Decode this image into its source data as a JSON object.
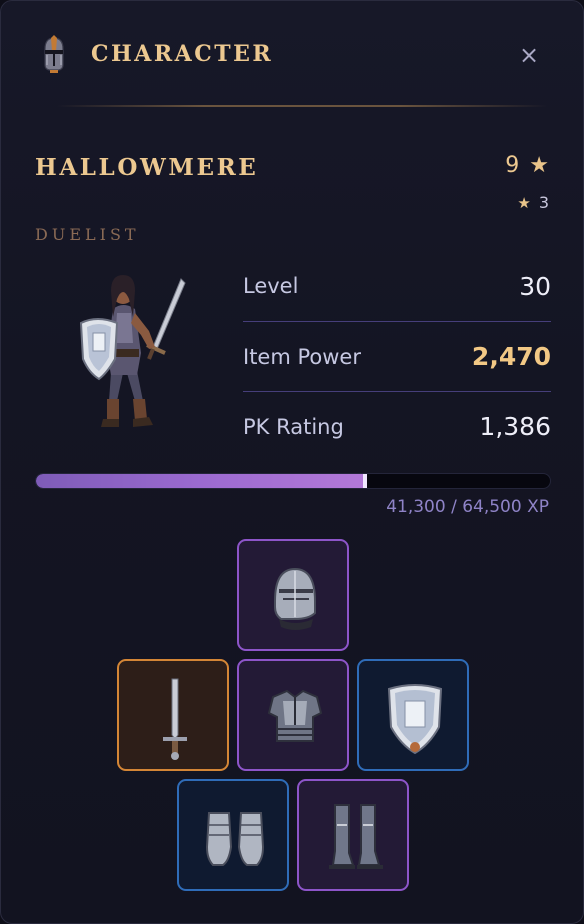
{
  "header": {
    "title": "CHARACTER",
    "icon": "knight-helm-icon",
    "close_label": "×"
  },
  "character": {
    "name": "HALLOWMERE",
    "class": "DUELIST",
    "stars": "9",
    "sub_stars": "3",
    "portrait": "duelist-portrait"
  },
  "stats": [
    {
      "label": "Level",
      "value": "30"
    },
    {
      "label": "Item Power",
      "value": "2,470"
    },
    {
      "label": "PK Rating",
      "value": "1,386"
    }
  ],
  "xp": {
    "current": 41300,
    "max": 64500,
    "text": "41,300 / 64,500 XP"
  },
  "equipment": [
    {
      "slot": "head",
      "item": "knight-helmet-icon",
      "rarity": "epic",
      "color": "#8d55c9"
    },
    {
      "slot": "weapon",
      "item": "longsword-icon",
      "rarity": "legendary",
      "color": "#d48636"
    },
    {
      "slot": "chest",
      "item": "plate-armor-icon",
      "rarity": "epic",
      "color": "#8d55c9"
    },
    {
      "slot": "offhand",
      "item": "kite-shield-icon",
      "rarity": "rare",
      "color": "#2f6cb8"
    },
    {
      "slot": "hands",
      "item": "gauntlets-icon",
      "rarity": "rare",
      "color": "#2f6cb8"
    },
    {
      "slot": "feet",
      "item": "greaves-icon",
      "rarity": "epic",
      "color": "#8d55c9"
    }
  ],
  "colors": {
    "gold": "#ecc890",
    "accent_purple": "#9b6ad0",
    "epic": "#8d55c9",
    "legendary": "#d48636",
    "rare": "#2f6cb8"
  }
}
